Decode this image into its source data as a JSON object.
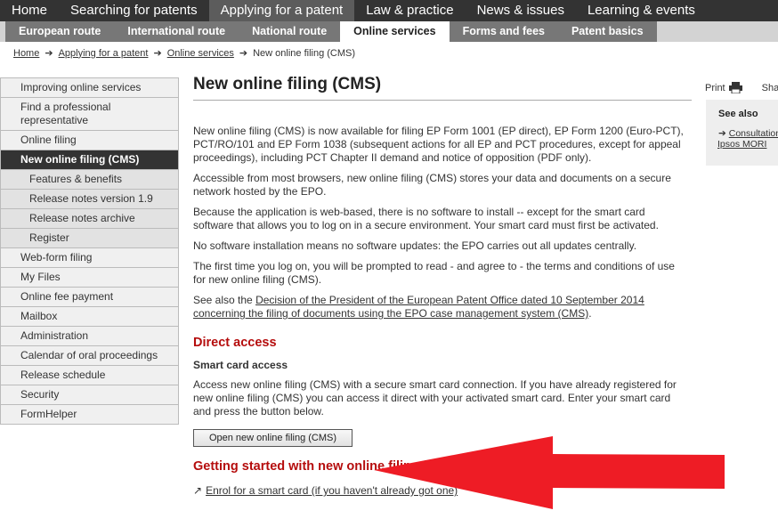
{
  "topnav": [
    "Home",
    "Searching for patents",
    "Applying for a patent",
    "Law & practice",
    "News & issues",
    "Learning & events"
  ],
  "subnav": [
    "European route",
    "International route",
    "National route",
    "Online services",
    "Forms and fees",
    "Patent basics"
  ],
  "breadcrumb": [
    "Home",
    "Applying for a patent",
    "Online services",
    "New online filing (CMS)"
  ],
  "sidebar": {
    "items": [
      "Improving online services",
      "Find a professional representative",
      "Online filing",
      "New online filing (CMS)",
      "Features & benefits",
      "Release notes version 1.9",
      "Release notes archive",
      "Register",
      "Web-form filing",
      "My Files",
      "Online fee payment",
      "Mailbox",
      "Administration",
      "Calendar of oral proceedings",
      "Release schedule",
      "Security",
      "FormHelper"
    ]
  },
  "main": {
    "title": "New online filing (CMS)",
    "p1": "New online filing (CMS) is now available for filing EP Form 1001 (EP direct), EP Form 1200 (Euro-PCT), PCT/RO/101 and EP Form 1038 (subsequent actions for all EP and PCT procedures, except for appeal proceedings), including PCT Chapter II demand and notice of opposition (PDF only).",
    "p2": "Accessible from most browsers, new online filing (CMS) stores your data and documents on a secure network hosted by the EPO.",
    "p3": "Because the application is web-based, there is no software to install -- except for the smart card software that allows you to log on in a secure environment. Your smart card must first be activated.",
    "p4": "No software installation means no software updates: the EPO carries out all updates centrally.",
    "p5": " The first time you log on, you will be prompted to read - and agree to - the terms and conditions of use for new online filing (CMS).",
    "p6_prefix": "See also the ",
    "p6_link": "Decision of the President of the European Patent Office dated 10 September 2014 concerning the filing of documents using the EPO case management system (CMS)",
    "p6_suffix": ".",
    "h_direct": "Direct access",
    "h_smart": "Smart card access",
    "p7": "Access new online filing (CMS) with a secure smart card connection. If you have already registered for new online filing (CMS) you can access it direct with your activated smart card. Enter your smart card and press the button below.",
    "button": "Open new online filing (CMS)",
    "h_start": "Getting started with new online filing (CMS)",
    "enrol_link": "Enrol for a smart card (if you haven't already got one)"
  },
  "right": {
    "print": "Print",
    "share": "Share",
    "seealso_title": "See also",
    "link1": "Consultation",
    "link2": "Ipsos MORI"
  },
  "colors": {
    "heading_red": "#b50d0d",
    "arrow_red": "#ee1c25",
    "nav_dark": "#333333"
  }
}
